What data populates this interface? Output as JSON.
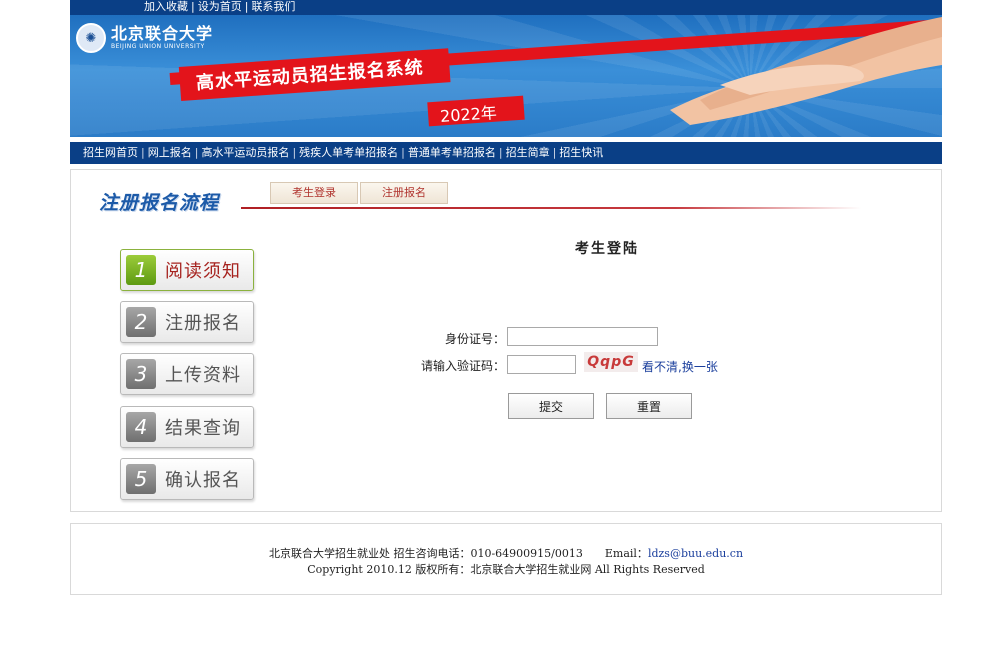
{
  "topbar": {
    "links": [
      "加入收藏",
      "设为首页",
      "联系我们"
    ],
    "separator": "|"
  },
  "banner": {
    "logo_cn": "北京联合大学",
    "logo_en": "BEIJING UNION UNIVERSITY",
    "title": "高水平运动员招生报名系统",
    "year": "2022年"
  },
  "nav": {
    "separator": "|",
    "items": [
      "招生网首页",
      "网上报名",
      "高水平运动员报名",
      "残疾人单考单招报名",
      "普通单考单招报名",
      "招生简章",
      "招生快讯"
    ]
  },
  "section": {
    "title": "注册报名流程",
    "tabs": [
      "考生登录",
      "注册报名"
    ]
  },
  "steps": [
    {
      "num": "1",
      "label": "阅读须知",
      "active": true
    },
    {
      "num": "2",
      "label": "注册报名",
      "active": false
    },
    {
      "num": "3",
      "label": "上传资料",
      "active": false
    },
    {
      "num": "4",
      "label": "结果查询",
      "active": false
    },
    {
      "num": "5",
      "label": "确认报名",
      "active": false
    }
  ],
  "login": {
    "title": "考生登陆",
    "id_label": "身份证号：",
    "id_value": "",
    "code_label": "请输入验证码：",
    "code_value": "",
    "captcha_text": "QqpG",
    "refresh_text": "看不清,换一张",
    "submit_label": "提交",
    "reset_label": "重置"
  },
  "footer": {
    "line1": "北京联合大学招生就业处 招生咨询电话：010-64900915/0013",
    "email_label": "Email：",
    "email": "ldzs@buu.edu.cn",
    "line2": "Copyright 2010.12 版权所有：北京联合大学招生就业网 All Rights Reserved"
  },
  "colors": {
    "nav_blue": "#0a3f86",
    "banner_red": "#e3141b",
    "step_active_green": "#5d9a12",
    "link_blue": "#1a3e9c"
  }
}
